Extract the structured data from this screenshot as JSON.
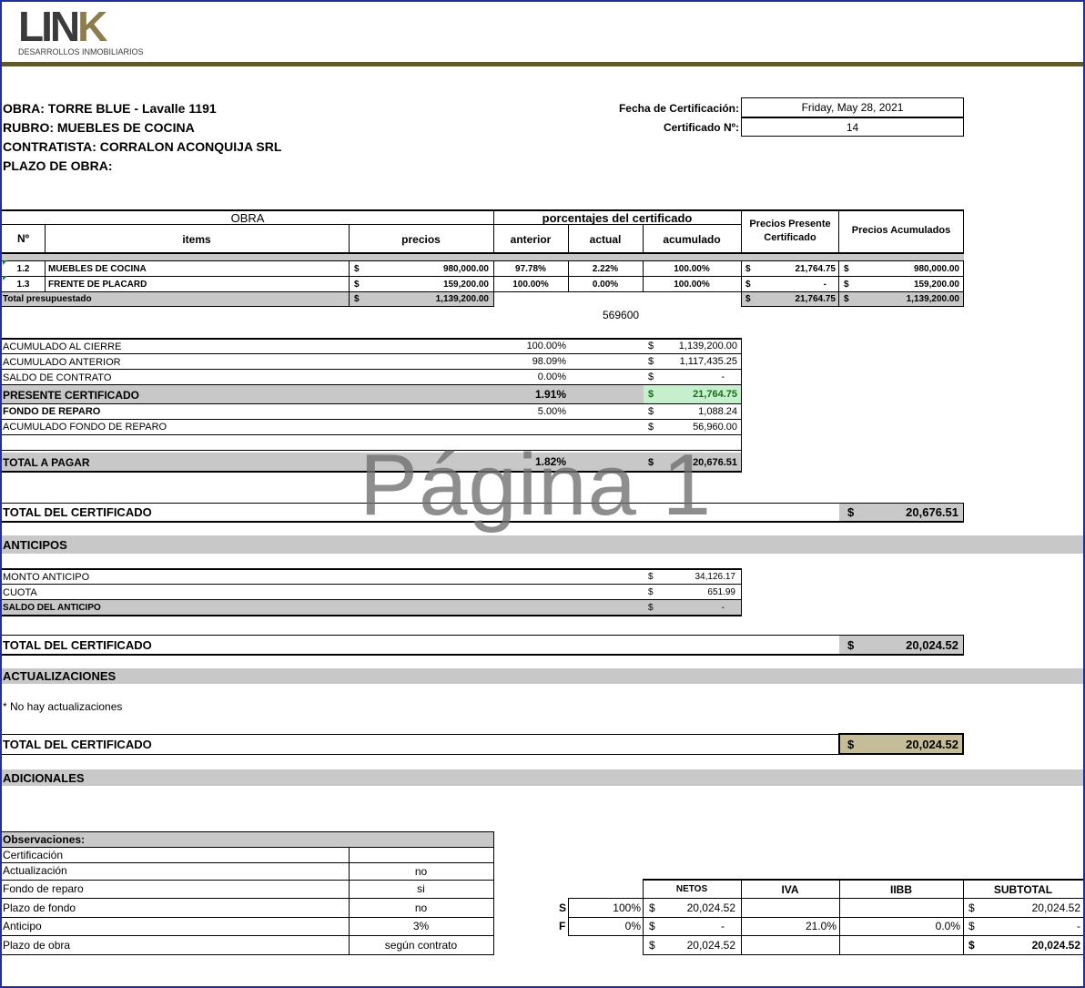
{
  "logo": {
    "text_main": "LIN",
    "text_k": "K",
    "subtitle": "DESARROLLOS INMOBILIARIOS",
    "accent": "#8c7c4e",
    "dark": "#3b3b3b"
  },
  "header": {
    "obra": "OBRA: TORRE BLUE - Lavalle 1191",
    "rubro": "RUBRO: MUEBLES DE COCINA",
    "contratista": "CONTRATISTA: CORRALON ACONQUIJA SRL",
    "plazo": "PLAZO DE OBRA:",
    "fecha_label": "Fecha de Certificación:",
    "fecha_value": "Friday, May 28, 2021",
    "cert_label": "Certificado Nº:",
    "cert_value": "14"
  },
  "main_table": {
    "group_obra": "OBRA",
    "group_pct": "porcentajes del certificado",
    "col_presente": "Precios Presente Certificado",
    "col_acumulados": "Precios Acumulados",
    "col_n": "Nº",
    "col_items": "items",
    "col_precios": "precios",
    "col_anterior": "anterior",
    "col_actual": "actual",
    "col_acumulado": "acumulado",
    "rows": [
      {
        "n": "1.2",
        "item": "MUEBLES DE COCINA",
        "cur": "$",
        "precio": "980,000.00",
        "anterior": "97.78%",
        "actual": "2.22%",
        "acumulado": "100.00%",
        "cur2": "$",
        "presente": "21,764.75",
        "cur3": "$",
        "acum": "980,000.00"
      },
      {
        "n": "1.3",
        "item": "FRENTE DE PLACARD",
        "cur": "$",
        "precio": "159,200.00",
        "anterior": "100.00%",
        "actual": "0.00%",
        "acumulado": "100.00%",
        "cur2": "$",
        "presente": "-",
        "cur3": "$",
        "acum": "159,200.00"
      }
    ],
    "total_label": "Total presupuestado",
    "total_cur": "$",
    "total_precio": "1,139,200.00",
    "total_cur2": "$",
    "total_presente": "21,764.75",
    "total_cur3": "$",
    "total_acum": "1,139,200.00",
    "stray_value": "569600"
  },
  "summary": {
    "rows": [
      {
        "label": "ACUMULADO AL CIERRE",
        "pct": "100.00%",
        "cur": "$",
        "value": "1,139,200.00"
      },
      {
        "label": "ACUMULADO ANTERIOR",
        "pct": "98.09%",
        "cur": "$",
        "value": "1,117,435.25"
      },
      {
        "label": "SALDO DE CONTRATO",
        "pct": "0.00%",
        "cur": "$",
        "value": "-"
      },
      {
        "label": "PRESENTE CERTIFICADO",
        "pct": "1.91%",
        "cur": "$",
        "value": "21,764.75"
      },
      {
        "label": "FONDO DE REPARO",
        "pct": "5.00%",
        "cur": "$",
        "value": "1,088.24"
      },
      {
        "label": "ACUMULADO FONDO DE REPARO",
        "pct": "",
        "cur": "$",
        "value": "56,960.00"
      }
    ],
    "total_label": "TOTAL A PAGAR",
    "total_pct": "1.82%",
    "total_cur": "$",
    "total_value": "20,676.51",
    "highlight_color": "#c6efce"
  },
  "watermark": "Página 1",
  "total_cert_1": {
    "label": "TOTAL DEL CERTIFICADO",
    "cur": "$",
    "value": "20,676.51"
  },
  "anticipos": {
    "title": "ANTICIPOS",
    "rows": [
      {
        "label": "MONTO ANTICIPO",
        "cur": "$",
        "value": "34,126.17"
      },
      {
        "label": "CUOTA",
        "cur": "$",
        "value": "651.99"
      },
      {
        "label": "SALDO DEL ANTICIPO",
        "cur": "$",
        "value": "-"
      }
    ]
  },
  "total_cert_2": {
    "label": "TOTAL DEL CERTIFICADO",
    "cur": "$",
    "value": "20,024.52"
  },
  "actualizaciones": {
    "title": "ACTUALIZACIONES",
    "note": "* No hay actualizaciones"
  },
  "total_cert_3": {
    "label": "TOTAL DEL CERTIFICADO",
    "cur": "$",
    "value": "20,024.52",
    "color": "#c4bd97"
  },
  "adicionales": {
    "title": "ADICIONALES"
  },
  "observaciones": {
    "title": "Observaciones:",
    "rows": [
      {
        "label": "Certificación",
        "value": ""
      },
      {
        "label": "Actualización",
        "value": "no"
      },
      {
        "label": "Fondo de reparo",
        "value": "si"
      },
      {
        "label": "Plazo de fondo",
        "value": "no"
      },
      {
        "label": "Anticipo",
        "value": "3%"
      },
      {
        "label": "Plazo de obra",
        "value": "según contrato"
      }
    ]
  },
  "taxes": {
    "col_netos": "NETOS",
    "col_iva": "IVA",
    "col_iibb": "IIBB",
    "col_subtotal": "SUBTOTAL",
    "rows": [
      {
        "code": "S",
        "pct": "100%",
        "cur": "$",
        "netos": "20,024.52",
        "iva": "",
        "iibb": "",
        "cur2": "$",
        "subtotal": "20,024.52"
      },
      {
        "code": "F",
        "pct": "0%",
        "cur": "$",
        "netos": "-",
        "iva": "21.0%",
        "iibb": "0.0%",
        "cur2": "$",
        "subtotal": "-"
      }
    ],
    "total_cur": "$",
    "total_netos": "20,024.52",
    "total_cur2": "$",
    "total_subtotal": "20,024.52"
  }
}
